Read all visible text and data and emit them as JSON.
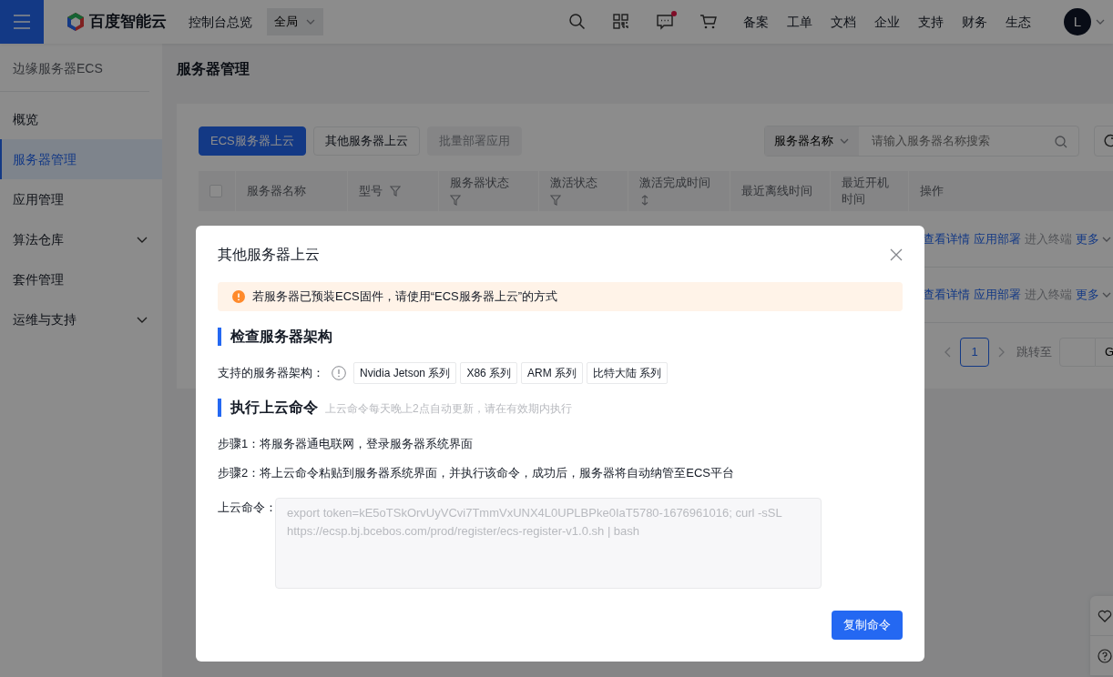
{
  "nav": {
    "logo_text": "百度智能云",
    "console": "控制台总览",
    "region": "全局",
    "messages_unread": true,
    "links": [
      "备案",
      "工单",
      "文档",
      "企业",
      "支持",
      "财务",
      "生态"
    ],
    "avatar": "L"
  },
  "sidebar": {
    "title": "边缘服务器ECS",
    "items": [
      {
        "label": "概览",
        "selected": false,
        "expandable": false
      },
      {
        "label": "服务器管理",
        "selected": true,
        "expandable": false
      },
      {
        "label": "应用管理",
        "selected": false,
        "expandable": false
      },
      {
        "label": "算法仓库",
        "selected": false,
        "expandable": true
      },
      {
        "label": "套件管理",
        "selected": false,
        "expandable": false
      },
      {
        "label": "运维与支持",
        "selected": false,
        "expandable": true
      }
    ]
  },
  "page": {
    "title": "服务器管理"
  },
  "toolbar": {
    "buttons": [
      {
        "label": "ECS服务器上云",
        "kind": "primary",
        "disabled": false
      },
      {
        "label": "其他服务器上云",
        "kind": "default",
        "disabled": false
      },
      {
        "label": "批量部署应用",
        "kind": "default",
        "disabled": true
      }
    ],
    "search": {
      "field": "服务器名称",
      "placeholder": "请输入服务器名称搜索"
    }
  },
  "table": {
    "columns": [
      {
        "label": "服务器名称",
        "kind": "plain"
      },
      {
        "label": "型号",
        "kind": "filter"
      },
      {
        "label": "服务器状态",
        "kind": "filterbelow"
      },
      {
        "label": "激活状态",
        "kind": "filterbelow"
      },
      {
        "label": "激活完成时间",
        "kind": "sortbelow"
      },
      {
        "label": "最近离线时间",
        "kind": "plain"
      },
      {
        "label": "最近开机时间",
        "kind": "plain"
      },
      {
        "label": "操作",
        "kind": "plain"
      }
    ],
    "select_all": {
      "checked": false
    },
    "rows": [
      {
        "actions": [
          {
            "label": "查看详情",
            "disabled": false
          },
          {
            "label": "应用部署",
            "disabled": false
          },
          {
            "label": "进入终端",
            "disabled": true
          },
          {
            "label": "更多",
            "disabled": false
          }
        ]
      },
      {
        "actions": [
          {
            "label": "查看详情",
            "disabled": false
          },
          {
            "label": "应用部署",
            "disabled": false
          },
          {
            "label": "进入终端",
            "disabled": true
          },
          {
            "label": "更多",
            "disabled": false
          }
        ]
      }
    ]
  },
  "pagination": {
    "pages": [
      {
        "label": "1",
        "selected": true
      }
    ],
    "jump_label": "跳转至",
    "go": "G"
  },
  "dialog": {
    "title": "其他服务器上云",
    "alert": "若服务器已预装ECS固件，请使用“ECS服务器上云”的方式",
    "sections": [
      {
        "title": "检查服务器架构"
      },
      {
        "title": "执行上云命令",
        "hint": "上云命令每天晚上2点自动更新，请在有效期内执行"
      }
    ],
    "arch_label": "支持的服务器架构：",
    "arch_tags": [
      "Nvidia Jetson 系列",
      "X86 系列",
      "ARM 系列",
      "比特大陆 系列"
    ],
    "steps": [
      "步骤1：将服务器通电联网，登录服务器系统界面",
      "步骤2：将上云命令粘贴到服务器系统界面，并执行该命令，成功后，服务器将自动纳管至ECS平台"
    ],
    "command_label": "上云命令：",
    "command": "export token=kE5oTSkOrvUyVCvi7TmmVxUNX4L0UPLBPke0IaT5780-1676961016; curl -sSL https://ecsp.bj.bcebos.com/prod/register/ecs-register-v1.0.sh | bash",
    "copy_button": "复制命令"
  }
}
